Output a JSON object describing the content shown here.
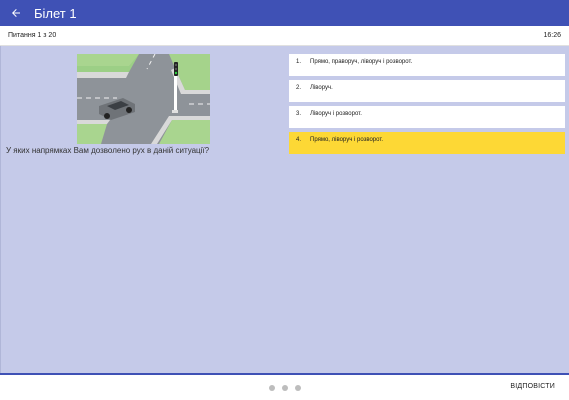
{
  "appbar": {
    "title": "Білет 1",
    "back_icon": "arrow-back-icon"
  },
  "status": {
    "progress": "Питання 1 з 20",
    "timer": "16:26"
  },
  "question": {
    "text": "У яких напрямках Вам дозволено рух в даній ситуації?"
  },
  "answers": [
    {
      "number": "1.",
      "text": "Прямо, праворуч, ліворуч і розворот.",
      "selected": false
    },
    {
      "number": "2.",
      "text": "Ліворуч.",
      "selected": false
    },
    {
      "number": "3.",
      "text": "Ліворуч і розворот.",
      "selected": false
    },
    {
      "number": "4.",
      "text": "Прямо, ліворуч і розворот.",
      "selected": true
    }
  ],
  "bottom": {
    "answer_button": "ВІДПОВІСТИ",
    "page_dots": 3
  },
  "colors": {
    "appbar": "#3f51b5",
    "background": "#c5cae9",
    "selected": "#fdd835"
  }
}
